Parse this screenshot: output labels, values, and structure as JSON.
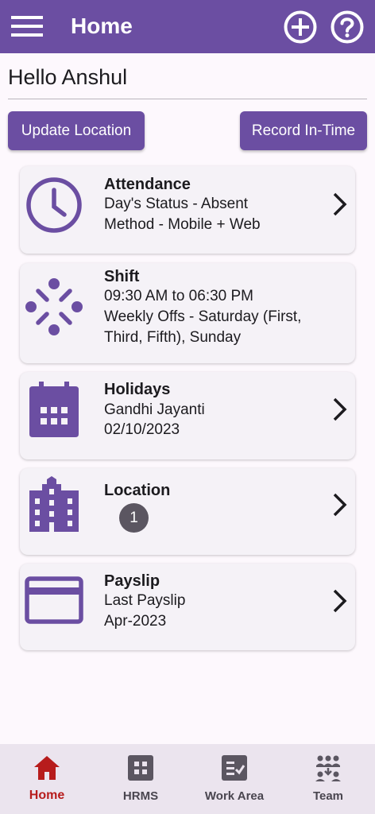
{
  "appbar": {
    "title": "Home",
    "menu_icon": "menu-icon",
    "add_icon": "add-circle-icon",
    "help_icon": "help-icon",
    "bg_color": "#6b4ea2"
  },
  "greeting": "Hello Anshul",
  "buttons": {
    "update_location": "Update Location",
    "record_in_time": "Record In-Time"
  },
  "cards": {
    "attendance": {
      "title": "Attendance",
      "line1": "Day's Status - Absent",
      "line2": "Method - Mobile + Web",
      "icon": "clock-icon"
    },
    "shift": {
      "title": "Shift",
      "line1": "09:30 AM to 06:30 PM",
      "line2": "Weekly Offs - Saturday (First,",
      "line3": "Third, Fifth), Sunday",
      "icon": "shift-dots-icon"
    },
    "holidays": {
      "title": "Holidays",
      "line1": "Gandhi Jayanti",
      "line2": "02/10/2023",
      "icon": "calendar-icon"
    },
    "location": {
      "title": "Location",
      "badge": "1",
      "icon": "building-icon"
    },
    "payslip": {
      "title": "Payslip",
      "line1": "Last Payslip",
      "line2": "Apr-2023",
      "icon": "credit-card-icon"
    }
  },
  "nav": {
    "items": [
      {
        "label": "Home",
        "icon": "home-icon",
        "active": true
      },
      {
        "label": "HRMS",
        "icon": "grid-icon",
        "active": false
      },
      {
        "label": "Work Area",
        "icon": "checklist-icon",
        "active": false
      },
      {
        "label": "Team",
        "icon": "team-icon",
        "active": false
      }
    ],
    "active_color": "#b71c1c"
  }
}
